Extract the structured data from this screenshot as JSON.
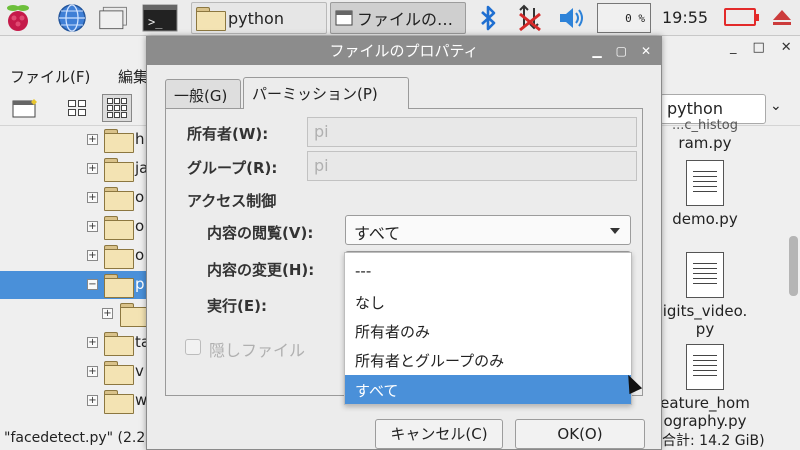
{
  "taskbar": {
    "tasks": [
      {
        "label": "python"
      },
      {
        "label": "ファイルの…"
      }
    ],
    "cpu_label": "0 %",
    "clock": "19:55"
  },
  "file_manager": {
    "menu": {
      "file": "ファイル(F)",
      "edit": "編集"
    },
    "path": "python",
    "tree": [
      {
        "label": "h"
      },
      {
        "label": "ja"
      },
      {
        "label": "o"
      },
      {
        "label": "o"
      },
      {
        "label": "o"
      },
      {
        "label": "p",
        "selected": true
      },
      {
        "label": ""
      },
      {
        "label": "ta"
      },
      {
        "label": "v"
      },
      {
        "label": "w"
      }
    ],
    "files": [
      {
        "line1": "ram.py",
        "line0": "...c_histog"
      },
      {
        "line1": "demo.py"
      },
      {
        "line1": "igits_video.",
        "line2": "py"
      },
      {
        "line1": "eature_hom",
        "line2": "ography.py"
      }
    ],
    "status_left": "\"facedetect.py\" (2.2",
    "status_right": "合計: 14.2 GiB)"
  },
  "dialog": {
    "title": "ファイルのプロパティ",
    "tabs": [
      {
        "label": "一般(G)"
      },
      {
        "label": "パーミッション(P)",
        "active": true
      }
    ],
    "owner_label": "所有者(W):",
    "owner_value": "pi",
    "group_label": "グループ(R):",
    "group_value": "pi",
    "access_heading": "アクセス制御",
    "view_label": "内容の閲覧(V):",
    "view_value": "すべて",
    "change_label": "内容の変更(H):",
    "exec_label": "実行(E):",
    "hidden_label": "隠しファイル",
    "cancel_button": "キャンセル(C)",
    "ok_button": "OK(O)",
    "dropdown_options": [
      {
        "label": "---"
      },
      {
        "label": "なし"
      },
      {
        "label": "所有者のみ"
      },
      {
        "label": "所有者とグループのみ"
      },
      {
        "label": "すべて",
        "highlighted": true
      }
    ]
  },
  "colors": {
    "selection": "#4a90d9",
    "titlebar": "#8c8c8c",
    "bluetooth": "#1f6fd1",
    "network_off": "#d62a2a",
    "battery": "#e32a2a"
  }
}
